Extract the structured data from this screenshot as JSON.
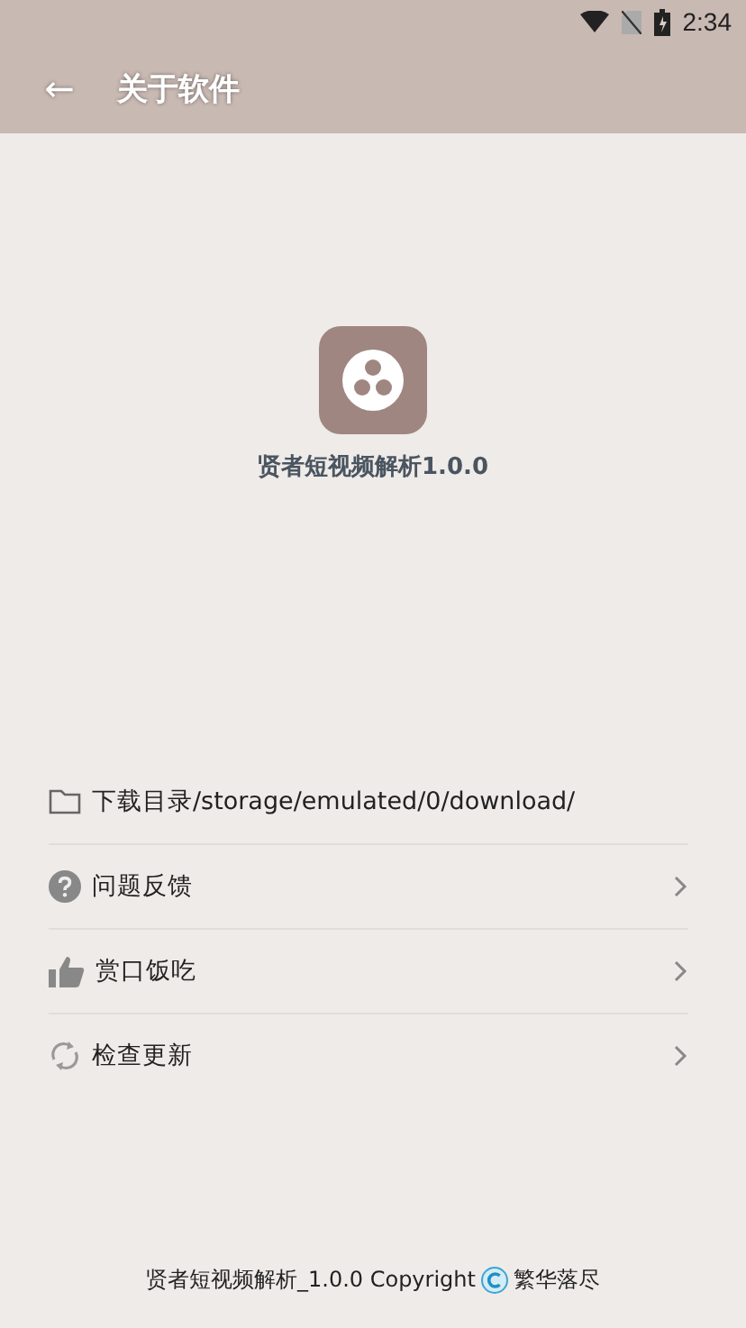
{
  "status_bar": {
    "time": "2:34"
  },
  "toolbar": {
    "back_icon": "←",
    "title": "关于软件"
  },
  "app": {
    "name": "贤者短视频解析1.0.0"
  },
  "items": [
    {
      "kind": "folder",
      "label": "下载目录/storage/emulated/0/download/",
      "has_arrow": false
    },
    {
      "kind": "help",
      "label": "问题反馈",
      "has_arrow": true
    },
    {
      "kind": "thumb",
      "label": "赏口饭吃",
      "has_arrow": true
    },
    {
      "kind": "refresh",
      "label": "检查更新",
      "has_arrow": true
    }
  ],
  "footer": {
    "before": "贤者短视频解析_1.0.0 Copyright",
    "after": "繁华落尽"
  }
}
